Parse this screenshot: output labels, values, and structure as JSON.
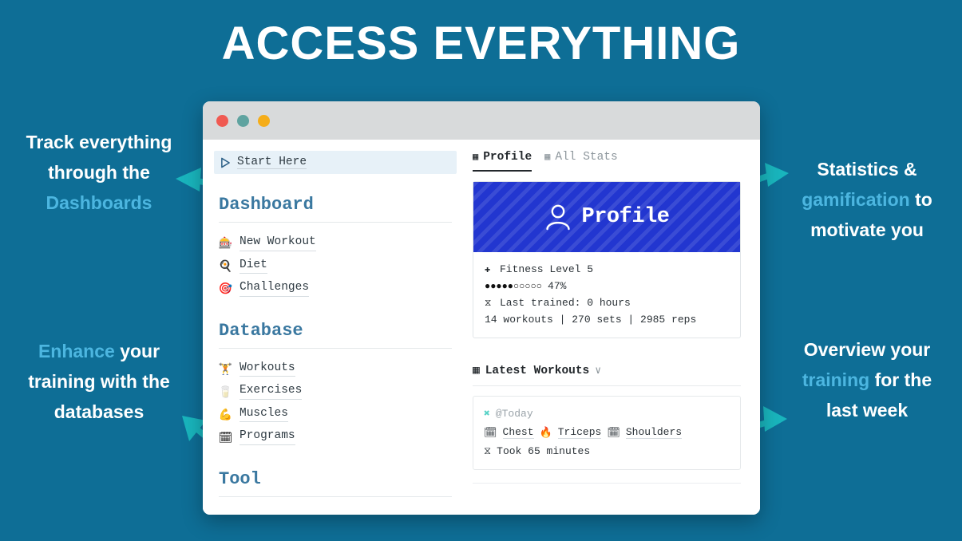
{
  "headline": "ACCESS EVERYTHING",
  "colors": {
    "background": "#0e6e96",
    "accent_teal": "#19b5bd",
    "highlight_text": "#4cb6e0",
    "heading_blue": "#3a78a0",
    "banner_blue": "#2236d0"
  },
  "callouts": {
    "top_left": {
      "line1": "Track everything",
      "line2": "through the",
      "highlight": "Dashboards"
    },
    "bottom_left": {
      "highlight": "Enhance",
      "line1": "your",
      "line2": "training with the",
      "line3": "databases"
    },
    "top_right": {
      "line1": "Statistics &",
      "highlight": "gamification",
      "line1b": "to",
      "line2": "motivate you"
    },
    "bottom_right": {
      "line1": "Overview your",
      "highlight": "training",
      "line1b": "for the",
      "line2": "last week"
    }
  },
  "window": {
    "titlebar": {
      "dots": [
        "close",
        "minimize",
        "maximize"
      ]
    },
    "sidebar": {
      "start_here": {
        "label": "Start Here",
        "icon": "play-triangle-icon"
      },
      "sections": [
        {
          "title": "Dashboard",
          "items": [
            {
              "label": "New Workout",
              "icon": "weight-plates-icon",
              "glyph": "🎰"
            },
            {
              "label": "Diet",
              "icon": "diet-pan-icon",
              "glyph": "🍳"
            },
            {
              "label": "Challenges",
              "icon": "dart-target-icon",
              "glyph": "🎯"
            }
          ]
        },
        {
          "title": "Database",
          "items": [
            {
              "label": "Workouts",
              "icon": "dumbbell-icon",
              "glyph": "🏋"
            },
            {
              "label": "Exercises",
              "icon": "kettlebell-icon",
              "glyph": "🥛"
            },
            {
              "label": "Muscles",
              "icon": "biceps-icon",
              "glyph": "💪"
            },
            {
              "label": "Programs",
              "icon": "calendar-icon",
              "glyph": "🗓"
            }
          ]
        },
        {
          "title": "Tool",
          "items": []
        }
      ]
    },
    "main": {
      "tabs": [
        {
          "label": "Profile",
          "icon": "grid-icon",
          "active": true
        },
        {
          "label": "All Stats",
          "icon": "grid-icon",
          "active": false
        }
      ],
      "profile_card": {
        "banner_title": "Profile",
        "banner_icon": "person-icon",
        "rows": [
          {
            "symbol": "✚",
            "text": "Fitness Level 5"
          },
          {
            "dots": "●●●●●○○○○○",
            "text": "47%"
          },
          {
            "symbol": "⧖",
            "text": "Last trained: 0 hours"
          },
          {
            "text": "14 workouts | 270 sets | 2985 reps"
          }
        ]
      },
      "latest_workouts": {
        "heading": "Latest Workouts",
        "heading_icon": "grid-icon",
        "chevron": "∨",
        "entry": {
          "date_icon": "pin-icon",
          "date": "@Today",
          "muscles": [
            {
              "label": "Chest",
              "glyph": "🗓"
            },
            {
              "label": "Triceps",
              "glyph": "🔥"
            },
            {
              "label": "Shoulders",
              "glyph": "🗓"
            }
          ],
          "duration_symbol": "⧖",
          "duration": "Took 65 minutes"
        }
      }
    }
  }
}
